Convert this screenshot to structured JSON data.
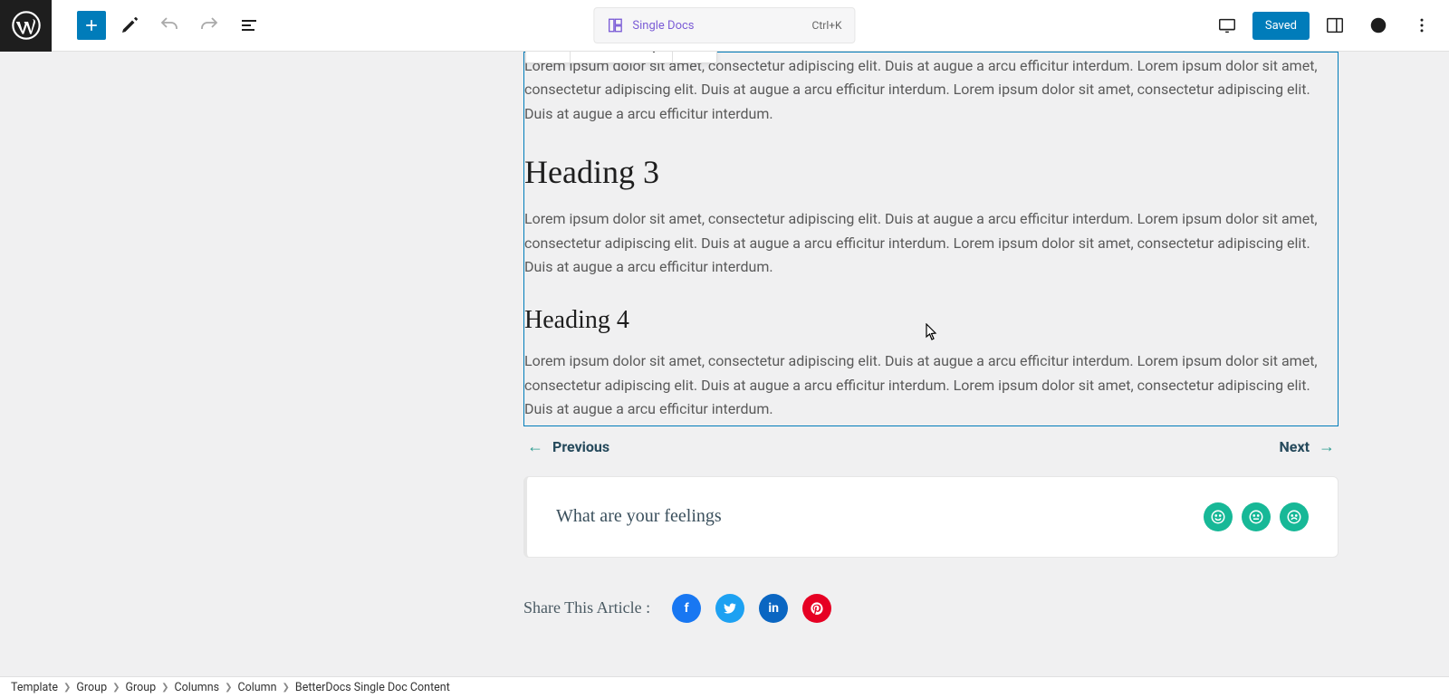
{
  "header": {
    "doc_label": "Single Docs",
    "shortcut": "Ctrl+K",
    "saved_label": "Saved"
  },
  "content": {
    "para1": "Lorem ipsum dolor sit amet, consectetur adipiscing elit. Duis at augue a arcu efficitur interdum. Lorem ipsum dolor sit amet, consectetur adipiscing elit. Duis at augue a arcu efficitur interdum. Lorem ipsum dolor sit amet, consectetur adipiscing elit. Duis at augue a arcu efficitur interdum.",
    "heading3": "Heading 3",
    "para2": "Lorem ipsum dolor sit amet, consectetur adipiscing elit. Duis at augue a arcu efficitur interdum. Lorem ipsum dolor sit amet, consectetur adipiscing elit. Duis at augue a arcu efficitur interdum. Lorem ipsum dolor sit amet, consectetur adipiscing elit. Duis at augue a arcu efficitur interdum.",
    "heading4": "Heading 4",
    "para3": "Lorem ipsum dolor sit amet, consectetur adipiscing elit. Duis at augue a arcu efficitur interdum. Lorem ipsum dolor sit amet, consectetur adipiscing elit. Duis at augue a arcu efficitur interdum. Lorem ipsum dolor sit amet, consectetur adipiscing elit. Duis at augue a arcu efficitur interdum."
  },
  "nav": {
    "prev": "Previous",
    "next": "Next"
  },
  "feelings": {
    "title": "What are your feelings"
  },
  "share": {
    "label": "Share This Article :"
  },
  "breadcrumb": {
    "items": [
      "Template",
      "Group",
      "Group",
      "Columns",
      "Column",
      "BetterDocs Single Doc Content"
    ]
  }
}
